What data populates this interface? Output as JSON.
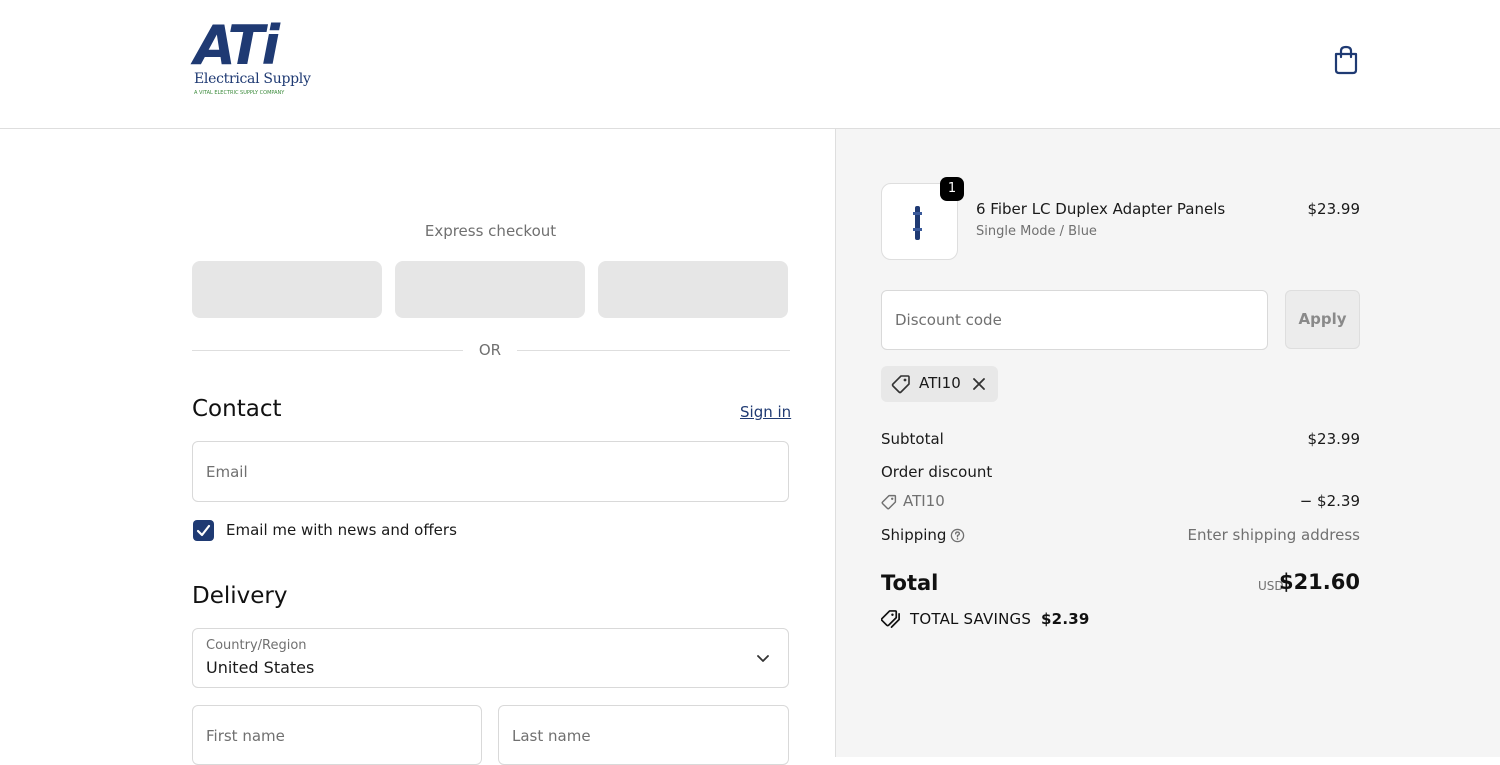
{
  "header": {
    "logo": {
      "main": "ATi",
      "sub": "Electrical Supply",
      "tagline": "A VITAL ELECTRIC SUPPLY COMPANY"
    },
    "cart_icon": "shopping-bag-icon"
  },
  "express": {
    "label": "Express checkout",
    "or_text": "OR"
  },
  "contact": {
    "title": "Contact",
    "sign_in": "Sign in",
    "email_placeholder": "Email",
    "newsletter_label": "Email me with news and offers",
    "newsletter_checked": true
  },
  "delivery": {
    "title": "Delivery",
    "country_label": "Country/Region",
    "country_value": "United States",
    "first_name_placeholder": "First name",
    "last_name_placeholder": "Last name"
  },
  "summary": {
    "product": {
      "quantity": "1",
      "name": "6 Fiber LC Duplex Adapter Panels",
      "variant": "Single Mode / Blue",
      "price": "$23.99"
    },
    "discount_placeholder": "Discount code",
    "apply_label": "Apply",
    "applied_code": "ATI10",
    "subtotal_label": "Subtotal",
    "subtotal_value": "$23.99",
    "order_discount_label": "Order discount",
    "discount_code": "ATI10",
    "discount_value": "− $2.39",
    "shipping_label": "Shipping",
    "shipping_value": "Enter shipping address",
    "total_label": "Total",
    "total_currency": "USD",
    "total_value": "$21.60",
    "savings_label": "TOTAL SAVINGS",
    "savings_value": "$2.39"
  },
  "colors": {
    "brand": "#1f3a73",
    "panel_bg": "#f5f5f5"
  }
}
